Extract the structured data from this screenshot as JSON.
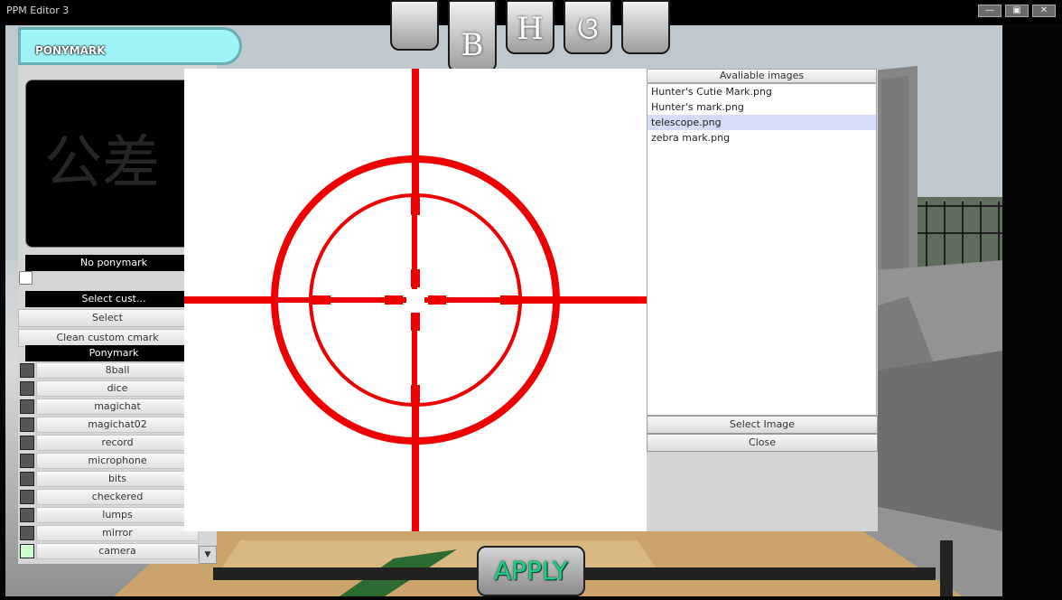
{
  "window": {
    "title": "PPM Editor 3",
    "controls": [
      "—",
      "▣",
      "✕"
    ]
  },
  "tabs": [
    {
      "glyph": ""
    },
    {
      "glyph": "B"
    },
    {
      "glyph": "H"
    },
    {
      "glyph": "ଓ"
    },
    {
      "glyph": ""
    }
  ],
  "ponymark": {
    "header": "PONYMARK",
    "preview_text": "公差",
    "current_label": "No ponymark",
    "select_custom_label": "Select cust...",
    "select_button": "Select",
    "clean_button": "Clean custom cmark",
    "section_label": "Ponymark",
    "items": [
      {
        "label": "8ball",
        "color": "#555555"
      },
      {
        "label": "dice",
        "color": "#555555"
      },
      {
        "label": "magichat",
        "color": "#555555"
      },
      {
        "label": "magichat02",
        "color": "#555555"
      },
      {
        "label": "record",
        "color": "#555555"
      },
      {
        "label": "microphone",
        "color": "#555555"
      },
      {
        "label": "bits",
        "color": "#555555"
      },
      {
        "label": "checkered",
        "color": "#555555"
      },
      {
        "label": "lumps",
        "color": "#555555"
      },
      {
        "label": "mirror",
        "color": "#555555"
      },
      {
        "label": "camera",
        "color": "#ccffcc"
      }
    ],
    "scroll_icon": "▼"
  },
  "image_picker": {
    "header": "Avaliable images",
    "files": [
      "Hunter's Cutie Mark.png",
      "Hunter's mark.png",
      "telescope.png",
      "zebra mark.png"
    ],
    "selected": "telescope.png",
    "select_button": "Select Image",
    "close_button": "Close",
    "preview_color": "#ee0000"
  },
  "apply_label": "APPLY",
  "colors": {
    "accent_cyan": "#9ef4f6",
    "apply_text": "#18d27a",
    "mark_red": "#ee0000"
  }
}
